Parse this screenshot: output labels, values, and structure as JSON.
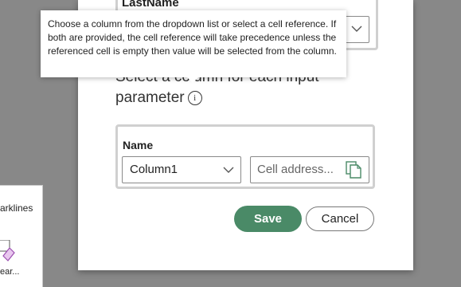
{
  "ribbon": {
    "label_top": "arklines",
    "label_bottom": "ear..."
  },
  "dialog": {
    "lastname_label": "LastName",
    "instruction": "Select a column for each input parameter",
    "parameter": {
      "name_label": "Name",
      "column_value": "Column1",
      "cell_placeholder": "Cell address..."
    },
    "save_label": "Save",
    "cancel_label": "Cancel"
  },
  "tooltip": {
    "text": "Choose a column from the dropdown list or select a cell reference. If both are provided, the cell reference will take precedence unless the referenced cell is empty then value will be selected from the column."
  },
  "colors": {
    "accent": "#4a8a67",
    "backdrop": "#888888"
  },
  "icons": [
    "info-icon",
    "chevron-down-icon",
    "copy-icon",
    "sparkline-icon"
  ]
}
